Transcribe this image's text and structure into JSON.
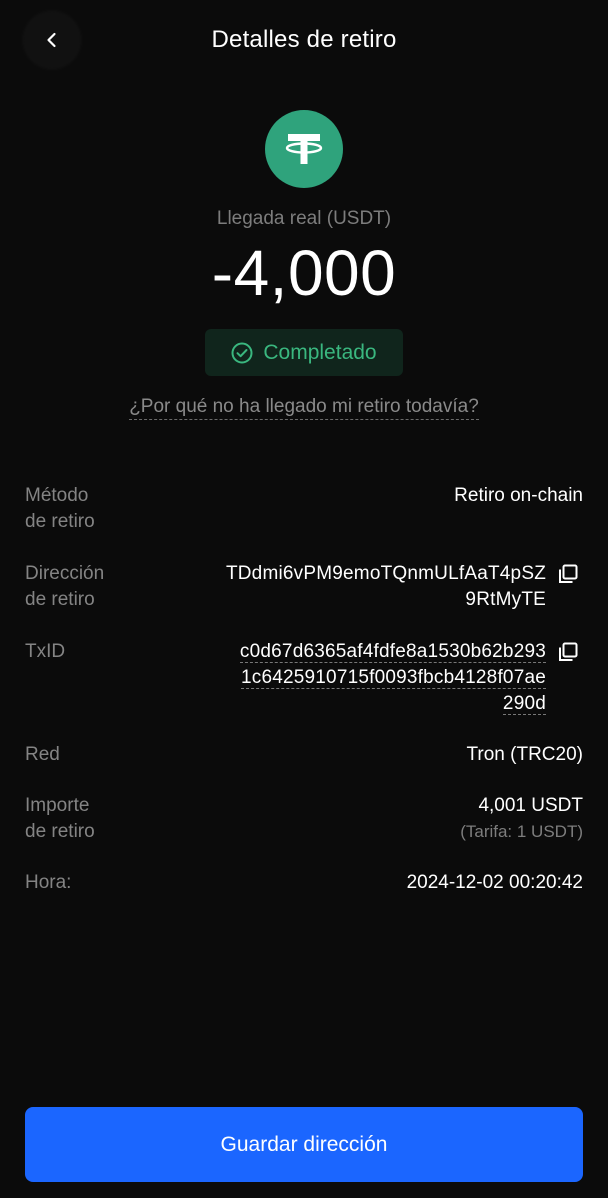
{
  "header": {
    "title": "Detalles de retiro"
  },
  "summary": {
    "coin_icon": "tether-icon",
    "coin_color": "#2fa37c",
    "arrival_label": "Llegada real (USDT)",
    "amount": "-4,000",
    "status": "Completado",
    "status_color": "#3ab77f",
    "help_link": "¿Por qué no ha llegado mi retiro todavía?"
  },
  "details": {
    "method": {
      "label_1": "Método",
      "label_2": "de retiro",
      "value": "Retiro on-chain"
    },
    "address": {
      "label_1": "Dirección",
      "label_2": "de retiro",
      "line_1": "TDdmi6vPM9emoTQnmULfAaT4pSZ",
      "line_2": "9RtMyTE"
    },
    "txid": {
      "label": "TxID",
      "line_1": "c0d67d6365af4fdfe8a1530b62b293",
      "line_2": "1c6425910715f0093fbcb4128f07ae",
      "line_3": "290d"
    },
    "network": {
      "label": "Red",
      "value": "Tron (TRC20)"
    },
    "amount": {
      "label_1": "Importe",
      "label_2": "de retiro",
      "value": "4,001 USDT",
      "fee": "(Tarifa: 1 USDT)"
    },
    "time": {
      "label": "Hora:",
      "value": "2024-12-02 00:20:42"
    }
  },
  "footer": {
    "save_label": "Guardar dirección",
    "accent_color": "#1b66ff"
  }
}
